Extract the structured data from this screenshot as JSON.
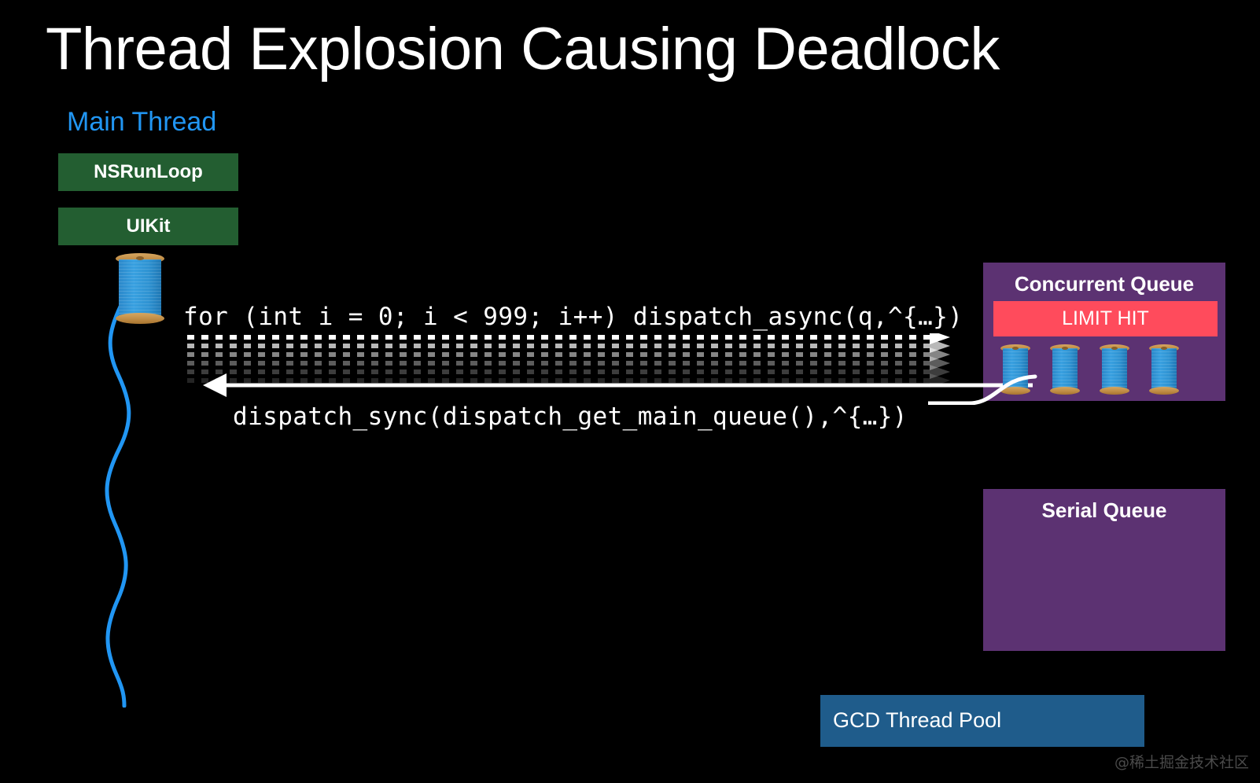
{
  "slide": {
    "title": "Thread Explosion Causing Deadlock",
    "background_color": "#000000"
  },
  "main_thread": {
    "label": "Main Thread",
    "label_color": "#2196F3",
    "stack": [
      {
        "name": "NSRunLoop",
        "color": "#235E31"
      },
      {
        "name": "UIKit",
        "color": "#235E31"
      }
    ],
    "spool_icon": "thread-spool-icon"
  },
  "code": {
    "async_line": "for (int i = 0; i < 999; i++) dispatch_async(q,^{…})",
    "sync_line": "dispatch_sync(dispatch_get_main_queue(),^{…})"
  },
  "arrows": {
    "async_fan_count": 6,
    "async_fan_style": "dashed",
    "async_fan_color": "#FFFFFF",
    "sync_return_style": "solid",
    "sync_return_color": "#FFFFFF",
    "sync_return_direction": "left"
  },
  "concurrent_queue": {
    "title": "Concurrent Queue",
    "color": "#5C3272",
    "badge": {
      "text": "LIMIT HIT",
      "color": "#FF4B5C"
    },
    "thread_count": 4
  },
  "serial_queue": {
    "title": "Serial Queue",
    "color": "#5C3272",
    "thread_count": 0
  },
  "gcd_pool": {
    "title": "GCD Thread Pool",
    "color": "#1F5C8B"
  },
  "watermark": {
    "text": "@稀土掘金技术社区"
  }
}
